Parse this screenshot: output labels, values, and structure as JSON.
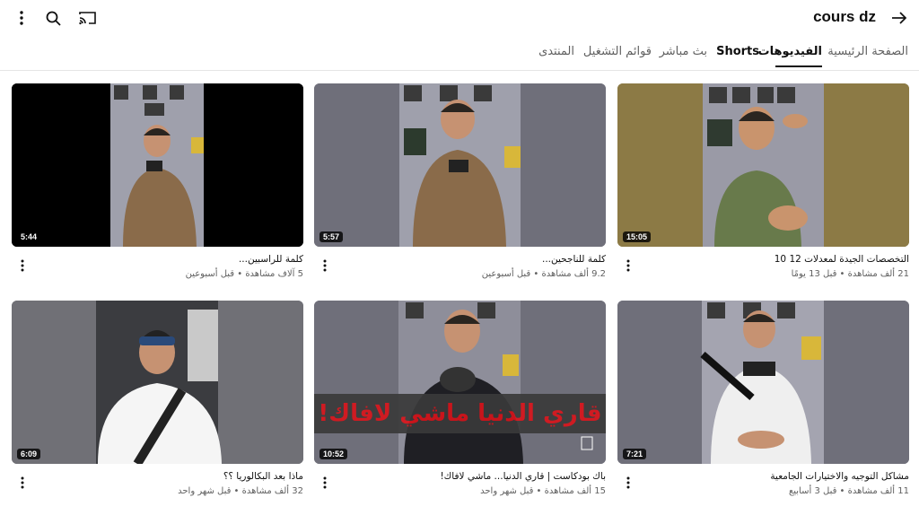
{
  "channel": {
    "title": "cours dz"
  },
  "tabs": [
    {
      "label": "الصفحة الرئيسية",
      "active": false
    },
    {
      "label": "الفيديوهات",
      "active": true
    },
    {
      "label": "Shorts",
      "active": false
    },
    {
      "label": "بث مباشر",
      "active": false
    },
    {
      "label": "قوائم التشغيل",
      "active": false
    },
    {
      "label": "المنتدى",
      "active": false
    }
  ],
  "videos": [
    {
      "title": "التخصصات الجيدة لمعدلات 12 10",
      "meta": "21 ألف مشاهدة • قبل 13 يومًا",
      "duration": "15:05"
    },
    {
      "title": "كلمة للناجحين...",
      "meta": "9.2 ألف مشاهدة • قبل أسبوعين",
      "duration": "5:57"
    },
    {
      "title": "كلمة للراسبين...",
      "meta": "5 آلاف مشاهدة • قبل أسبوعين",
      "duration": "5:44"
    },
    {
      "title": "مشاكل التوجيه والاختيارات الجامعية",
      "meta": "11 ألف مشاهدة • قبل 3 أسابيع",
      "duration": "7:21"
    },
    {
      "title": "باك بودكاست | قاري الدنيا... ماشي لافاك!",
      "meta": "15 ألف مشاهدة • قبل شهر واحد",
      "duration": "10:52",
      "overlay": "قاري الدنيا ماشي لافاك!"
    },
    {
      "title": "ماذا بعد البكالوريا ؟؟",
      "meta": "32 ألف مشاهدة • قبل شهر واحد",
      "duration": "6:09"
    }
  ],
  "icons": {
    "back": "arrow-right-icon",
    "cast": "cast-icon",
    "search": "search-icon",
    "more": "more-vert-icon"
  }
}
